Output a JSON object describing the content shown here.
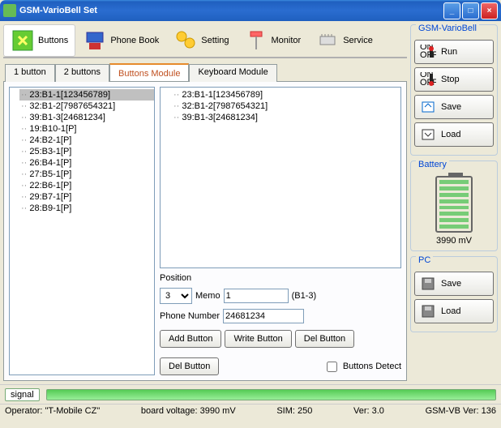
{
  "window": {
    "title": "GSM-VarioBell Set"
  },
  "toolbar": [
    {
      "id": "buttons",
      "label": "Buttons",
      "active": true
    },
    {
      "id": "phonebook",
      "label": "Phone Book"
    },
    {
      "id": "setting",
      "label": "Setting"
    },
    {
      "id": "monitor",
      "label": "Monitor"
    },
    {
      "id": "service",
      "label": "Service"
    }
  ],
  "tabs": [
    {
      "id": "1btn",
      "label": "1 button"
    },
    {
      "id": "2btn",
      "label": "2 buttons"
    },
    {
      "id": "bmod",
      "label": "Buttons Module",
      "active": true
    },
    {
      "id": "kmod",
      "label": "Keyboard Module"
    }
  ],
  "tree": [
    {
      "label": "23:B1-1[123456789]",
      "selected": true
    },
    {
      "label": "32:B1-2[7987654321]"
    },
    {
      "label": "39:B1-3[24681234]"
    },
    {
      "label": "19:B10-1[P]"
    },
    {
      "label": "24:B2-1[P]"
    },
    {
      "label": "25:B3-1[P]"
    },
    {
      "label": "26:B4-1[P]"
    },
    {
      "label": "27:B5-1[P]"
    },
    {
      "label": "22:B6-1[P]"
    },
    {
      "label": "29:B7-1[P]"
    },
    {
      "label": "28:B9-1[P]"
    }
  ],
  "listbox": [
    {
      "label": "23:B1-1[123456789]"
    },
    {
      "label": "32:B1-2[7987654321]"
    },
    {
      "label": "39:B1-3[24681234]"
    }
  ],
  "form": {
    "position_label": "Position",
    "position_value": "3",
    "memo_label": "Memo",
    "memo_value": "1",
    "memo_suffix": "(B1-3)",
    "phone_label": "Phone Number",
    "phone_value": "24681234",
    "add_btn": "Add Button",
    "write_btn": "Write Button",
    "del_btn": "Del Button",
    "del_btn2": "Del Button",
    "detect_label": "Buttons Detect"
  },
  "side": {
    "group1": "GSM-VarioBell",
    "run": "Run",
    "stop": "Stop",
    "save": "Save",
    "load": "Load",
    "battery_label": "Battery",
    "battery_mv": "3990 mV",
    "pc_label": "PC",
    "pc_save": "Save",
    "pc_load": "Load"
  },
  "status": {
    "signal": "signal",
    "operator": "Operator: \"T-Mobile CZ\"",
    "voltage": "board voltage: 3990 mV",
    "sim": "SIM: 250",
    "ver": "Ver: 3.0",
    "gsmvb": "GSM-VB Ver: 136"
  }
}
